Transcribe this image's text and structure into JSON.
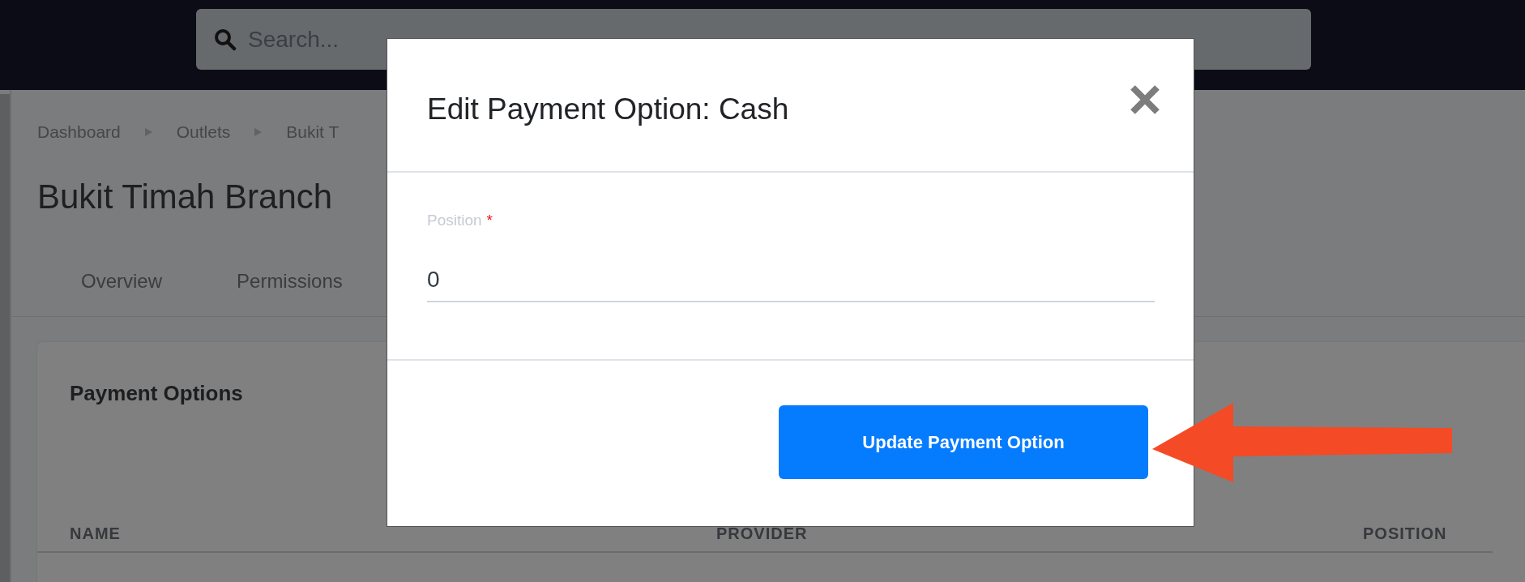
{
  "search": {
    "placeholder": "Search..."
  },
  "breadcrumbs": [
    "Dashboard",
    "Outlets",
    "Bukit T"
  ],
  "page_title": "Bukit Timah Branch",
  "tabs": [
    {
      "label": "Overview",
      "selected": false
    },
    {
      "label": "Permissions",
      "selected": false
    }
  ],
  "card": {
    "title": "Payment Options",
    "columns": [
      "NAME",
      "PROVIDER",
      "POSITION"
    ]
  },
  "modal": {
    "title": "Edit Payment Option: Cash",
    "field": {
      "label": "Position",
      "required_mark": "*",
      "value": "0"
    },
    "button": "Update Payment Option"
  }
}
